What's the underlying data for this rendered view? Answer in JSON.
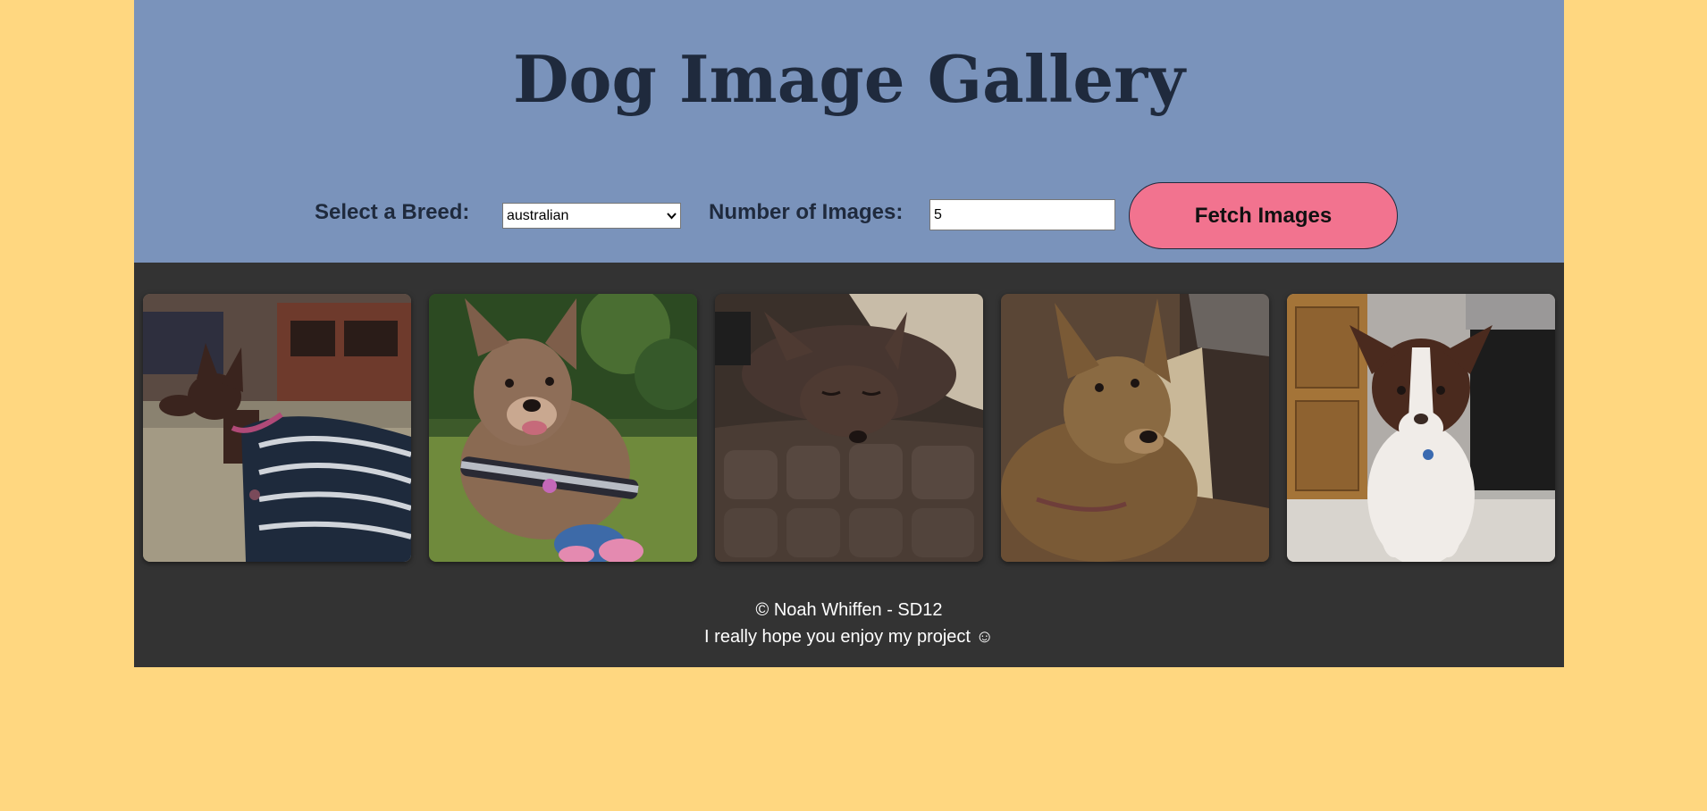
{
  "header": {
    "title": "Dog Image Gallery"
  },
  "controls": {
    "breed_label": "Select a Breed:",
    "breed_selected": "australian",
    "count_label": "Number of Images:",
    "count_value": "5",
    "fetch_label": "Fetch Images"
  },
  "gallery": {
    "images": [
      {
        "name": "dog-photo-1"
      },
      {
        "name": "dog-photo-2"
      },
      {
        "name": "dog-photo-3"
      },
      {
        "name": "dog-photo-4"
      },
      {
        "name": "dog-photo-5"
      }
    ]
  },
  "footer": {
    "line1": "© Noah Whiffen - SD12",
    "line2": "I really hope you enjoy my project ☺"
  },
  "colors": {
    "page_bg": "#ffd780",
    "header_bg": "#7a93bb",
    "gallery_bg": "#333333",
    "button_bg": "#f2738f",
    "heading_text": "#1f2a3d"
  }
}
